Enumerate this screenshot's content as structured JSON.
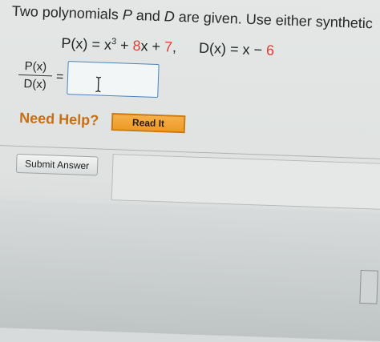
{
  "problem": {
    "intro_before_p": "Two polynomials ",
    "p_var": "P",
    "mid_text": " and ",
    "d_var": "D",
    "intro_after_d": " are given. Use either synthetic"
  },
  "equation": {
    "p_lhs": "P(x) = x",
    "p_exp": "3",
    "p_plus1": " + ",
    "p_coef": "8",
    "p_x": "x",
    "p_plus2": " + ",
    "p_const": "7",
    "comma": ",",
    "d_lhs": "D(x) = x − ",
    "d_const": "6"
  },
  "fraction": {
    "numerator": "P(x)",
    "denominator": "D(x)",
    "equals": "="
  },
  "help": {
    "need_help": "Need Help?",
    "read_it": "Read It"
  },
  "submit": {
    "label": "Submit Answer"
  },
  "colors": {
    "accent_red": "#e03d37",
    "help_orange": "#c86e13",
    "input_border": "#4a84c0"
  }
}
